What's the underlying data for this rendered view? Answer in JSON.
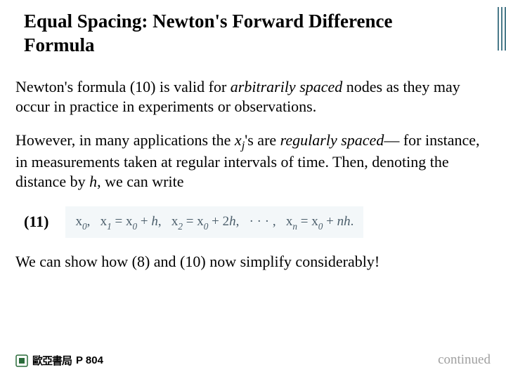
{
  "header": {
    "title_line1": "Equal Spacing: Newton's Forward Difference",
    "title_line2": "Formula"
  },
  "paragraphs": {
    "p1_a": "Newton's formula (10) is valid for ",
    "p1_em": "arbitrarily spaced",
    "p1_b": " nodes as they may occur in practice in experiments or observations.",
    "p2_a": "However, in many applications the ",
    "p2_var": "x",
    "p2_sub": "j",
    "p2_b": "'s are ",
    "p2_em": "regularly spaced",
    "p2_c": "— for instance, in measurements taken at regular intervals of time. Then, denoting the distance by ",
    "p2_var2": "h",
    "p2_d": ", we can write",
    "p3": "We can show how (8) and (10) now simplify considerably!"
  },
  "equation": {
    "label": "(11)",
    "text": "x₀,   x₁ = x₀ + h,   x₂ = x₀ + 2h,   · · · ,   xₙ = x₀ + nh."
  },
  "footer": {
    "publisher": "歐亞書局",
    "page": "P 804",
    "continued": "continued"
  }
}
